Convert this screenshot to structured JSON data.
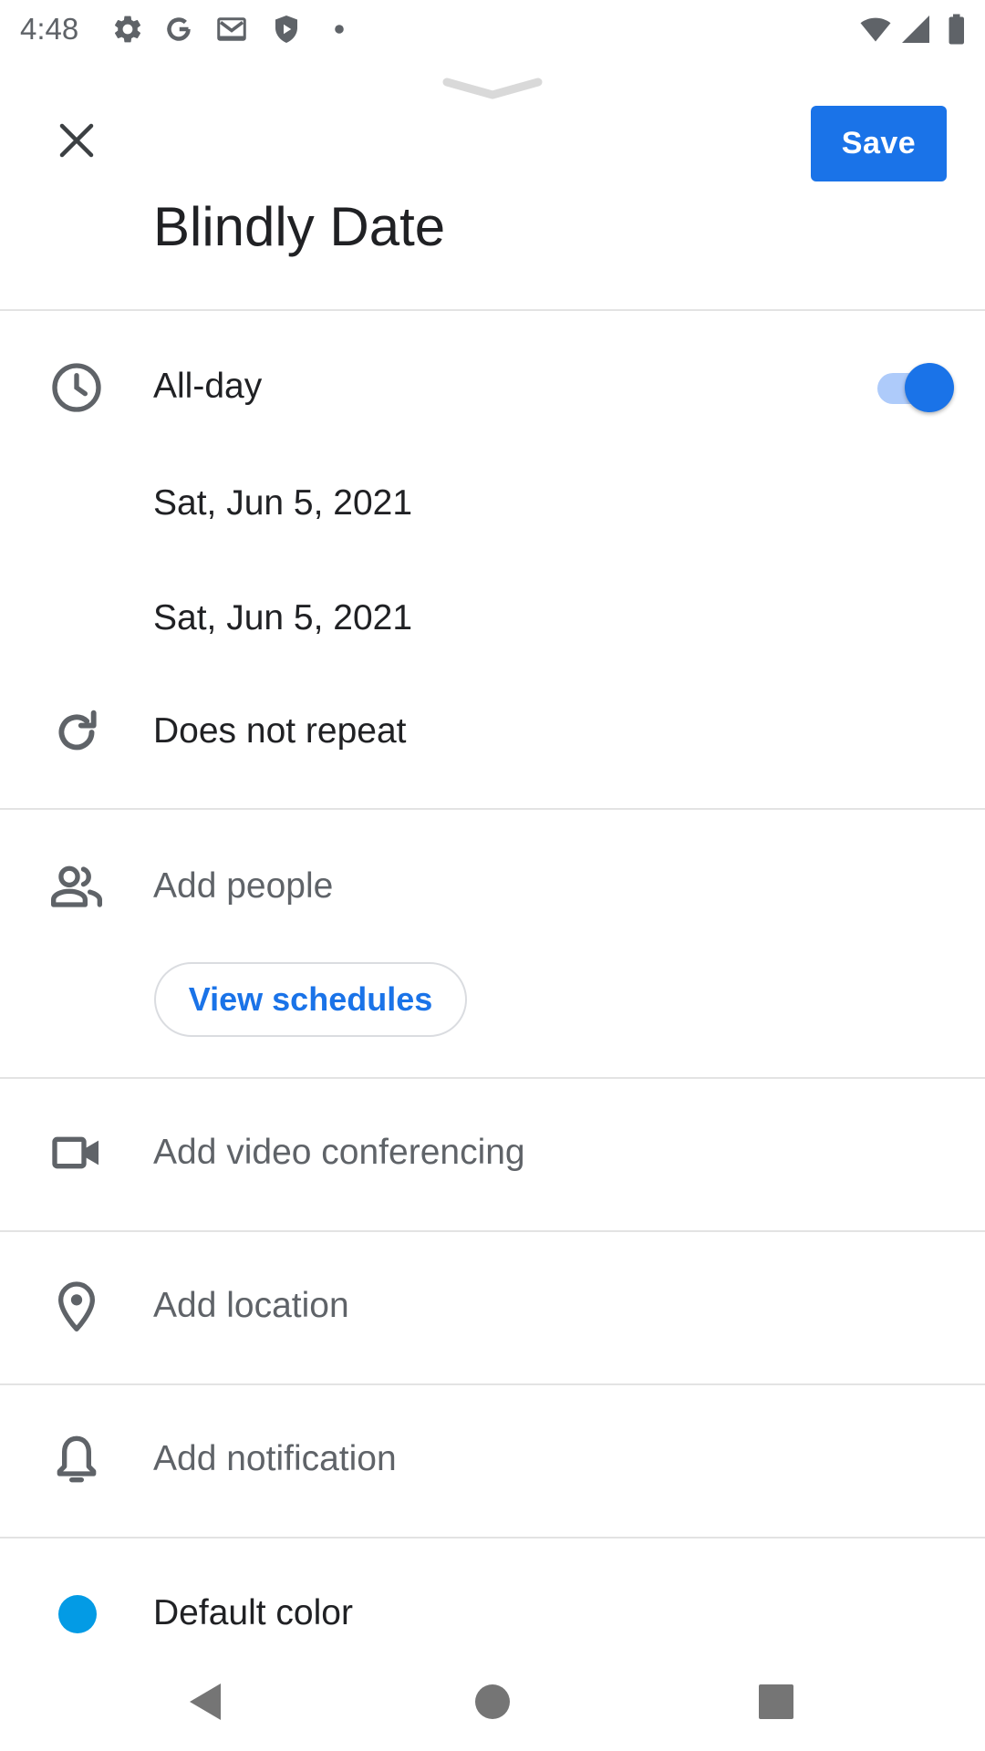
{
  "status_bar": {
    "time": "4:48",
    "left_icons": [
      "settings-icon",
      "google-icon",
      "gmail-icon",
      "shield-icon",
      "dot-icon"
    ],
    "right_icons": [
      "wifi-icon",
      "signal-icon",
      "battery-icon"
    ]
  },
  "header": {
    "save_label": "Save",
    "title": "Blindly Date"
  },
  "time_section": {
    "all_day_label": "All-day",
    "all_day_on": true,
    "start_date": "Sat, Jun 5, 2021",
    "end_date": "Sat, Jun 5, 2021",
    "repeat_label": "Does not repeat"
  },
  "people_section": {
    "add_people_label": "Add people",
    "view_schedules_label": "View schedules"
  },
  "video_section": {
    "label": "Add video conferencing"
  },
  "location_section": {
    "label": "Add location"
  },
  "notification_section": {
    "label": "Add notification"
  },
  "color_section": {
    "label": "Default color",
    "color": "#039be5"
  },
  "colors": {
    "accent": "#1a73e8",
    "toggle_track": "#aecbfa",
    "text_primary": "#202124",
    "text_hint": "#5f6368"
  }
}
